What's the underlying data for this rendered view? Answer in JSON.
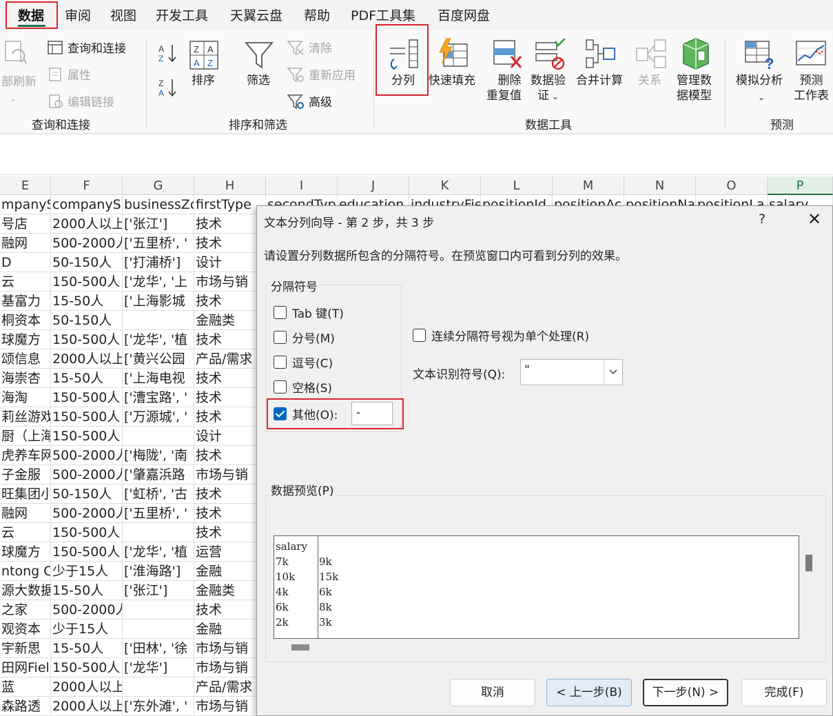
{
  "menu": {
    "tabs": [
      "数据",
      "审阅",
      "视图",
      "开发工具",
      "天翼云盘",
      "帮助",
      "PDF工具集",
      "百度网盘"
    ],
    "active": "数据"
  },
  "ribbon": {
    "query_group": {
      "label": "查询和连接",
      "refresh": "部刷新",
      "queries": "查询和连接",
      "properties": "属性",
      "edit_links": "编辑链接"
    },
    "sort_group": {
      "label": "排序和筛选",
      "sort": "排序",
      "filter": "筛选",
      "clear": "清除",
      "reapply": "重新应用",
      "advanced": "高级"
    },
    "tools_group": {
      "label": "数据工具",
      "text_to_columns": "分列",
      "flash_fill": "快速填充",
      "remove_dup_1": "删除",
      "remove_dup_2": "重复值",
      "validation_1": "数据验",
      "validation_2": "证",
      "consolidate": "合并计算",
      "relationships": "关系",
      "data_model_1": "管理数",
      "data_model_2": "据模型"
    },
    "forecast_group": {
      "label": "预测",
      "what_if": "模拟分析",
      "forecast_1": "预测",
      "forecast_2": "工作表"
    }
  },
  "sheet": {
    "columns": [
      "E",
      "F",
      "G",
      "H",
      "I",
      "J",
      "K",
      "L",
      "M",
      "N",
      "O",
      "P"
    ],
    "header_row": [
      "mpanyS",
      "companyS",
      "businessZc",
      "firstType",
      "secondTyp",
      "education",
      "industryFie",
      "positionId",
      "positionAc",
      "positionNa",
      "positionLa",
      "salary"
    ],
    "rows": [
      [
        "号店",
        "2000人以上",
        "['张江']",
        "技术"
      ],
      [
        "融网",
        "500-2000人",
        "['五里桥', '",
        "技术"
      ],
      [
        "D",
        "50-150人",
        "['打浦桥']",
        "设计"
      ],
      [
        "云",
        "150-500人",
        "['龙华', '上",
        "市场与销"
      ],
      [
        "基富力",
        "15-50人",
        "['上海影城",
        "技术"
      ],
      [
        "桐资本",
        "50-150人",
        "",
        "金融类"
      ],
      [
        "球魔方",
        "150-500人",
        "['龙华', '植",
        "技术"
      ],
      [
        "颂信息",
        "2000人以上",
        "['黄兴公园",
        "产品/需求"
      ],
      [
        "海崇杏",
        "15-50人",
        "['上海电视",
        "技术"
      ],
      [
        "海淘",
        "150-500人",
        "['漕宝路', '",
        "技术"
      ],
      [
        "莉丝游戏",
        "150-500人",
        "['万源城', '",
        "技术"
      ],
      [
        "厨（上海",
        "150-500人",
        "",
        "设计"
      ],
      [
        "虎养车网",
        "500-2000人",
        "['梅陇', '南",
        "技术"
      ],
      [
        "子金服",
        "500-2000人",
        "['肇嘉浜路",
        "市场与销"
      ],
      [
        "旺集团小",
        "50-150人",
        "['虹桥', '古",
        "技术"
      ],
      [
        "融网",
        "500-2000人",
        "['五里桥', '",
        "技术"
      ],
      [
        "云",
        "150-500人",
        "",
        "技术"
      ],
      [
        "球魔方",
        "150-500人",
        "['龙华', '植",
        "运营"
      ],
      [
        "ntong Ca",
        "少于15人",
        "['淮海路']",
        "金融"
      ],
      [
        "源大数据",
        "15-50人",
        "['张江']",
        "金融类"
      ],
      [
        "之家",
        "500-2000人",
        "",
        "技术"
      ],
      [
        "观资本",
        "少于15人",
        "",
        "金融"
      ],
      [
        "宇新思",
        "15-50人",
        "['田林', '徐",
        "市场与销"
      ],
      [
        "田网Fiel",
        "150-500人",
        "['龙华']",
        "市场与销"
      ],
      [
        "蓝",
        "2000人以上",
        "",
        "产品/需求"
      ],
      [
        "森路透",
        "2000人以上",
        "['东外滩', '",
        "市场与销"
      ]
    ]
  },
  "dialog": {
    "title": "文本分列向导 - 第 2 步，共 3 步",
    "help": "?",
    "close": "✕",
    "description": "请设置分列数据所包含的分隔符号。在预览窗口内可看到分列的效果。",
    "delimiters_label": "分隔符号",
    "tab": "Tab 键(T)",
    "semicolon": "分号(M)",
    "comma": "逗号(C)",
    "space": "空格(S)",
    "other": "其他(O):",
    "other_value": "-",
    "consecutive": "连续分隔符号视为单个处理(R)",
    "qualifier_label": "文本识别符号(Q):",
    "qualifier_value": "\"",
    "preview_label": "数据预览(P)",
    "preview_col1": [
      "salary",
      "7k",
      "10k",
      "4k",
      "6k",
      "2k"
    ],
    "preview_col2": [
      "",
      "9k",
      "15k",
      "6k",
      "8k",
      "3k"
    ],
    "buttons": {
      "cancel": "取消",
      "back": "< 上一步(B)",
      "next": "下一步(N) >",
      "finish": "完成(F)"
    }
  }
}
